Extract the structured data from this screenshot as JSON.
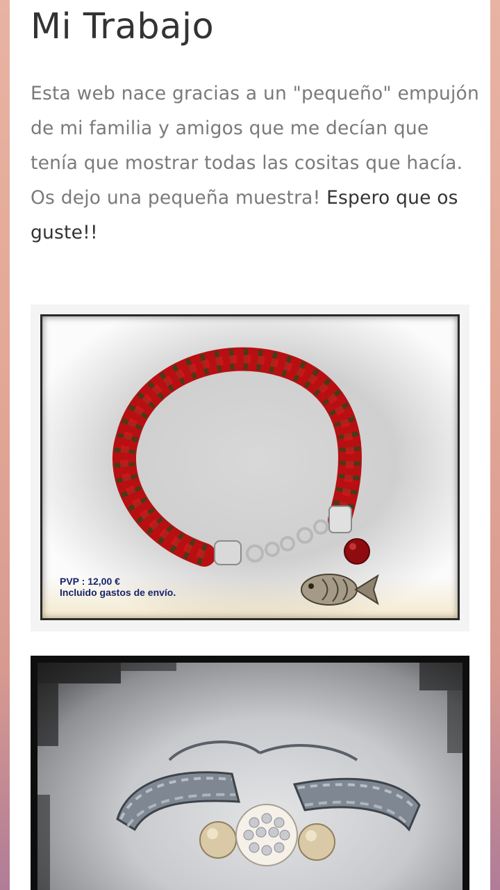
{
  "page": {
    "title": "Mi Trabajo",
    "intro_text": "Esta web nace gracias a un \"pequeño\" empujón de mi familia y amigos que me decían que tenía que mostrar todas las cositas que hacía. Os dejo una pequeña muestra!",
    "intro_emphasis": "Espero que os guste!!"
  },
  "gallery": {
    "item1": {
      "price_label": "PVP : 12,00 €",
      "shipping_label": "Incluido gastos de envío."
    }
  },
  "colors": {
    "background": "#e3a896",
    "card": "#ffffff",
    "title_text": "#333333",
    "body_text": "#7a7a7a",
    "price_text": "#15246b"
  }
}
